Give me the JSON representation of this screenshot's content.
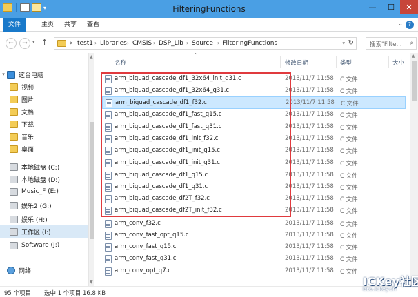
{
  "window": {
    "title": "FilteringFunctions",
    "min_glyph": "—",
    "max_glyph": "☐",
    "close_glyph": "✕"
  },
  "ribbon": {
    "tabs": [
      {
        "label": "文件",
        "active": true
      },
      {
        "label": "主页"
      },
      {
        "label": "共享"
      },
      {
        "label": "查看"
      }
    ],
    "help_glyph": "?"
  },
  "address": {
    "overflow": "«",
    "crumbs": [
      "test1",
      "Libraries",
      "CMSIS",
      "DSP_Lib",
      "Source",
      "FilteringFunctions"
    ],
    "separator": "›",
    "search_placeholder": "搜索\"Filte..."
  },
  "nav": {
    "items": [
      {
        "label": "这台电脑",
        "icon": "computer-icon",
        "expand": "▾"
      },
      {
        "label": "视频",
        "icon": "folder-icon"
      },
      {
        "label": "图片",
        "icon": "folder-icon"
      },
      {
        "label": "文档",
        "icon": "folder-icon"
      },
      {
        "label": "下载",
        "icon": "folder-icon"
      },
      {
        "label": "音乐",
        "icon": "folder-icon"
      },
      {
        "label": "桌面",
        "icon": "folder-icon"
      },
      {
        "label": "本地磁盘 (C:)",
        "icon": "drive-icon"
      },
      {
        "label": "本地磁盘 (D:)",
        "icon": "drive-icon"
      },
      {
        "label": "Music_F (E:)",
        "icon": "drive-icon"
      },
      {
        "label": "娱乐2 (G:)",
        "icon": "drive-icon"
      },
      {
        "label": "娱乐 (H:)",
        "icon": "drive-icon"
      },
      {
        "label": "工作区 (I:)",
        "icon": "drive-icon",
        "selected": true
      },
      {
        "label": "Software (J:)",
        "icon": "drive-icon"
      },
      {
        "label": "网络",
        "icon": "network-icon"
      }
    ]
  },
  "list": {
    "columns": {
      "name": "名称",
      "date": "修改日期",
      "type": "类型",
      "size": "大小"
    },
    "rows": [
      {
        "name": "arm_biquad_cascade_df1_32x64_init_q31.c",
        "date": "2013/11/7 11:58",
        "type": "C 文件"
      },
      {
        "name": "arm_biquad_cascade_df1_32x64_q31.c",
        "date": "2013/11/7 11:58",
        "type": "C 文件"
      },
      {
        "name": "arm_biquad_cascade_df1_f32.c",
        "date": "2013/11/7 11:58",
        "type": "C 文件",
        "selected": true
      },
      {
        "name": "arm_biquad_cascade_df1_fast_q15.c",
        "date": "2013/11/7 11:58",
        "type": "C 文件"
      },
      {
        "name": "arm_biquad_cascade_df1_fast_q31.c",
        "date": "2013/11/7 11:58",
        "type": "C 文件"
      },
      {
        "name": "arm_biquad_cascade_df1_init_f32.c",
        "date": "2013/11/7 11:58",
        "type": "C 文件"
      },
      {
        "name": "arm_biquad_cascade_df1_init_q15.c",
        "date": "2013/11/7 11:58",
        "type": "C 文件"
      },
      {
        "name": "arm_biquad_cascade_df1_init_q31.c",
        "date": "2013/11/7 11:58",
        "type": "C 文件"
      },
      {
        "name": "arm_biquad_cascade_df1_q15.c",
        "date": "2013/11/7 11:58",
        "type": "C 文件"
      },
      {
        "name": "arm_biquad_cascade_df1_q31.c",
        "date": "2013/11/7 11:58",
        "type": "C 文件"
      },
      {
        "name": "arm_biquad_cascade_df2T_f32.c",
        "date": "2013/11/7 11:58",
        "type": "C 文件"
      },
      {
        "name": "arm_biquad_cascade_df2T_init_f32.c",
        "date": "2013/11/7 11:58",
        "type": "C 文件"
      },
      {
        "name": "arm_conv_f32.c",
        "date": "2013/11/7 11:58",
        "type": "C 文件"
      },
      {
        "name": "arm_conv_fast_opt_q15.c",
        "date": "2013/11/7 11:58",
        "type": "C 文件"
      },
      {
        "name": "arm_conv_fast_q15.c",
        "date": "2013/11/7 11:58",
        "type": "C 文件"
      },
      {
        "name": "arm_conv_fast_q31.c",
        "date": "2013/11/7 11:58",
        "type": "C 文件"
      },
      {
        "name": "arm_conv_opt_q7.c",
        "date": "2013/11/7 11:58",
        "type": "C 文件"
      }
    ]
  },
  "status": {
    "count": "95 个项目",
    "selection": "选中 1 个项目 16.8 KB"
  },
  "watermark": {
    "main": "ICKey社区",
    "sub": "bbs.ickey.cn"
  },
  "colors": {
    "titlebar": "#4a9fe4",
    "file_tab": "#1979ca",
    "highlight_box": "#e03a3e",
    "selection": "#cce8ff"
  }
}
